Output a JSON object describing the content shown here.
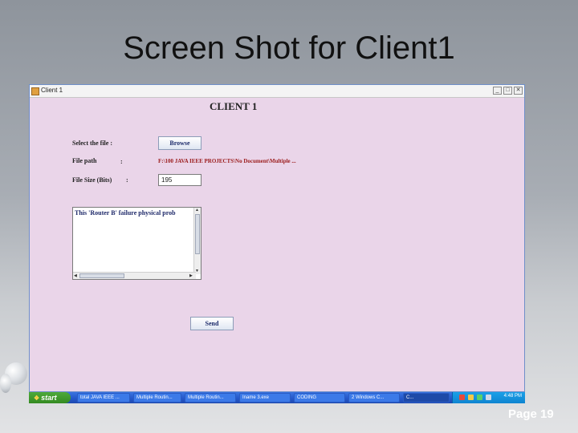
{
  "slide": {
    "title": "Screen Shot for Client1",
    "page_number": "Page 19"
  },
  "window": {
    "title": "Client 1",
    "controls": {
      "minimize": "_",
      "maximize": "□",
      "close": "✕"
    }
  },
  "form": {
    "heading": "CLIENT 1",
    "select_file_label": "Select the file :",
    "browse_label": "Browse",
    "file_path_label": "File path",
    "file_path_colon": ":",
    "file_path_value": "F:\\100 JAVA IEEE PROJECTS\\No Document\\Multiple ...",
    "file_size_label": "File Size (Bits)",
    "file_size_colon": ":",
    "file_size_value": "195",
    "content_text": "This 'Router B' failure physical prob",
    "send_label": "Send"
  },
  "taskbar": {
    "start_label": "start",
    "items": [
      "total JAVA IEEE ...",
      "Multiple Routin...",
      "Multiple Routin...",
      "Iname 3.exe",
      "CODING",
      "2 Windows C...",
      "C..."
    ],
    "time": "4:48 PM"
  },
  "colors": {
    "window_background": "#ead5e9",
    "taskbar_blue": "#2456c8",
    "start_green": "#338a22",
    "file_path_red": "#9a1a1a"
  }
}
